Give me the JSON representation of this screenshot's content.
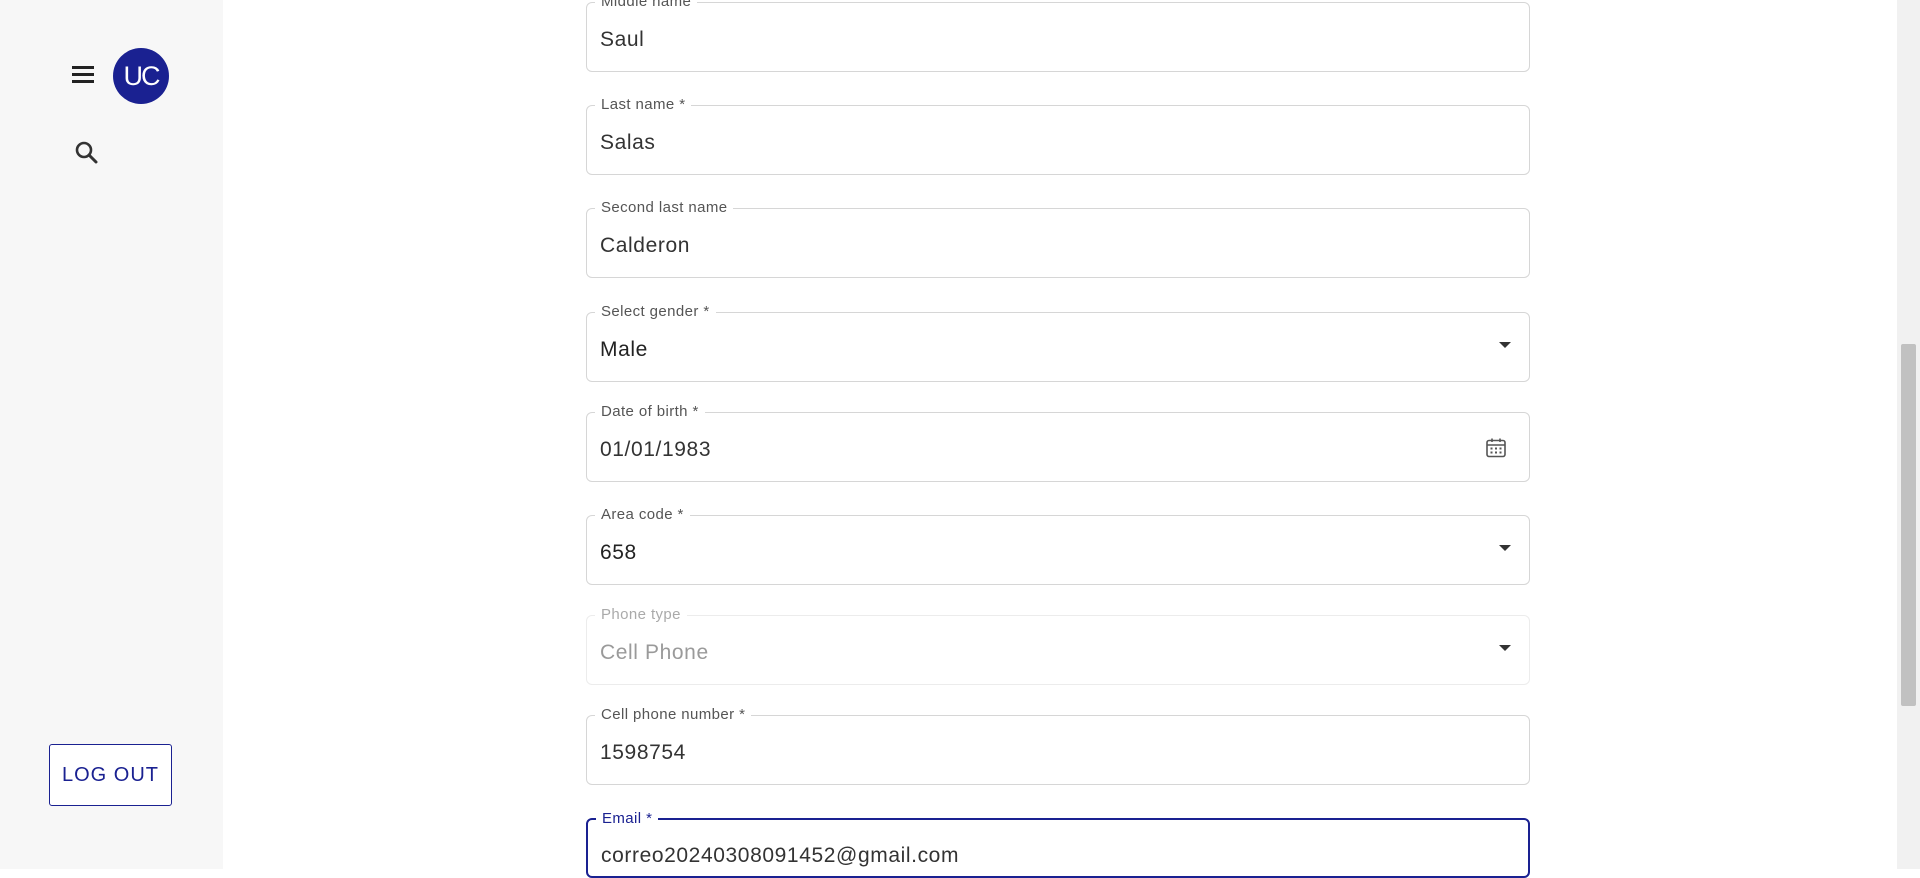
{
  "sidebar": {
    "avatar_initials": "UC",
    "logout_label": "LOG OUT"
  },
  "form": {
    "middle_name": {
      "label": "Middle name",
      "value": "Saul"
    },
    "last_name": {
      "label": "Last name *",
      "value": "Salas"
    },
    "second_last_name": {
      "label": "Second last name",
      "value": "Calderon"
    },
    "gender": {
      "label": "Select gender *",
      "value": "Male"
    },
    "date_of_birth": {
      "label": "Date of birth *",
      "value": "01/01/1983"
    },
    "area_code": {
      "label": "Area code *",
      "value": "658"
    },
    "phone_type": {
      "label": "Phone type",
      "value": "Cell Phone"
    },
    "cell_phone": {
      "label": "Cell phone number *",
      "value": "1598754"
    },
    "email": {
      "label": "Email",
      "required_mark": "*",
      "value": "correo20240308091452@gmail.com"
    }
  },
  "icons": {
    "menu": "hamburger-menu-icon",
    "search": "search-icon",
    "dropdown": "chevron-down-icon",
    "calendar": "calendar-icon"
  },
  "colors": {
    "accent": "#1a2191",
    "sidebar_bg": "#f7f7f7",
    "border": "#d6d6d6"
  }
}
